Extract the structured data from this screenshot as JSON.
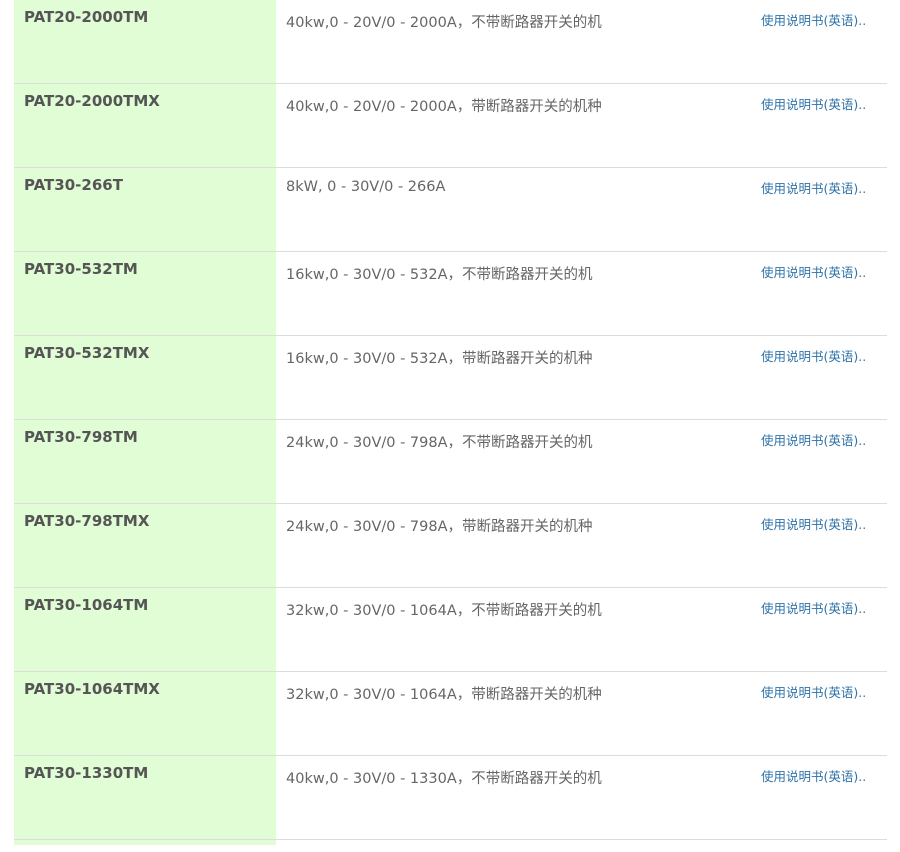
{
  "rows": [
    {
      "model": "PAT20-2000TM",
      "desc": "40kw,0 - 20V/0 - 2000A，不带断路器开关的机",
      "link": "使用说明书(英语).."
    },
    {
      "model": "PAT20-2000TMX",
      "desc": "40kw,0 - 20V/0 - 2000A，带断路器开关的机种",
      "link": "使用说明书(英语).."
    },
    {
      "model": "PAT30-266T",
      "desc": "8kW, 0 - 30V/0 - 266A",
      "link": "使用说明书(英语).."
    },
    {
      "model": "PAT30-532TM",
      "desc": "16kw,0 - 30V/0 - 532A，不带断路器开关的机",
      "link": "使用说明书(英语).."
    },
    {
      "model": "PAT30-532TMX",
      "desc": "16kw,0 - 30V/0 - 532A，带断路器开关的机种",
      "link": "使用说明书(英语).."
    },
    {
      "model": "PAT30-798TM",
      "desc": "24kw,0 - 30V/0 - 798A，不带断路器开关的机",
      "link": "使用说明书(英语).."
    },
    {
      "model": "PAT30-798TMX",
      "desc": "24kw,0 - 30V/0 - 798A，带断路器开关的机种",
      "link": "使用说明书(英语).."
    },
    {
      "model": "PAT30-1064TM",
      "desc": "32kw,0 - 30V/0 - 1064A，不带断路器开关的机",
      "link": "使用说明书(英语).."
    },
    {
      "model": "PAT30-1064TMX",
      "desc": "32kw,0 - 30V/0 - 1064A，带断路器开关的机种",
      "link": "使用说明书(英语).."
    },
    {
      "model": "PAT30-1330TM",
      "desc": "40kw,0 - 30V/0 - 1330A，不带断路器开关的机",
      "link": "使用说明书(英语).."
    }
  ]
}
